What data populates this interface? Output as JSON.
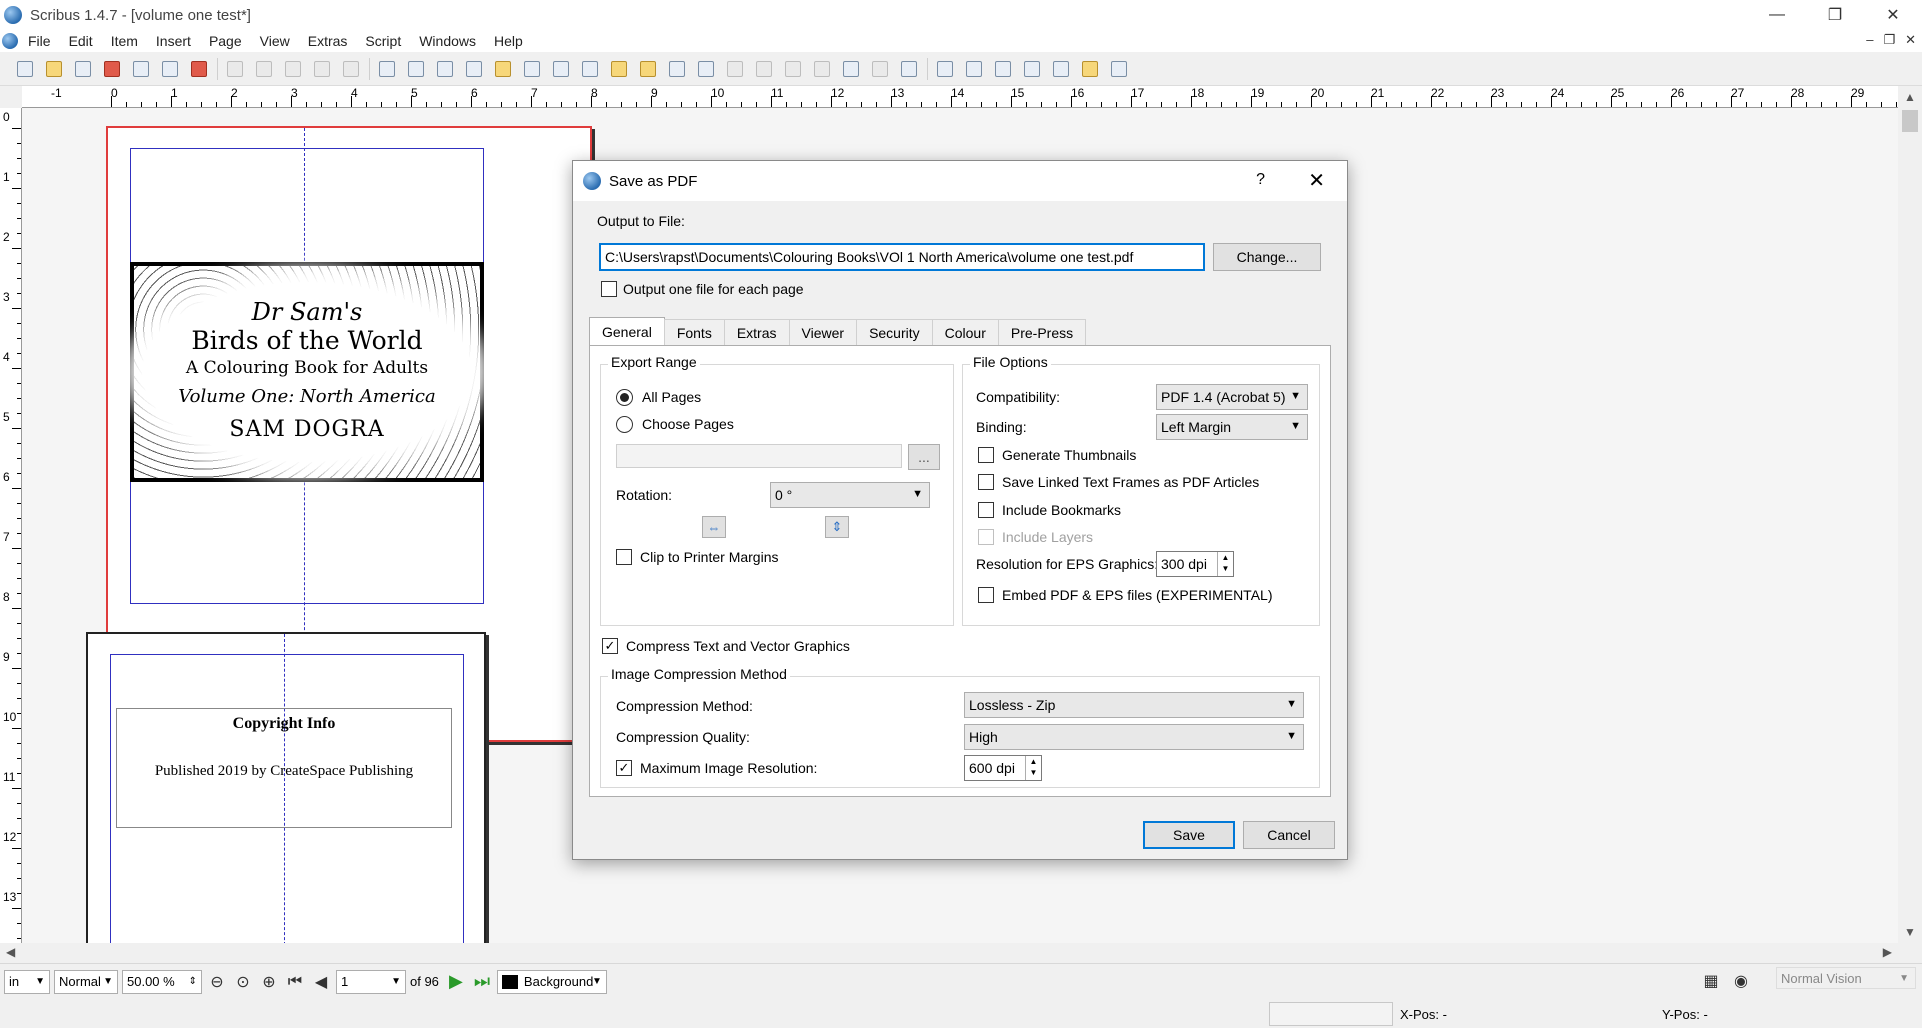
{
  "window": {
    "title": "Scribus 1.4.7 - [volume one test*]",
    "controls": [
      "—",
      "❐",
      "✕"
    ]
  },
  "menu": {
    "items": [
      "File",
      "Edit",
      "Item",
      "Insert",
      "Page",
      "View",
      "Extras",
      "Script",
      "Windows",
      "Help"
    ],
    "mdi_controls": [
      "–",
      "❐",
      "✕"
    ]
  },
  "ruler_h": [
    "-1",
    "0",
    "1",
    "2",
    "3",
    "4",
    "5",
    "6",
    "7",
    "8",
    "9",
    "10",
    "11",
    "12",
    "13",
    "14",
    "15",
    "16",
    "17",
    "18",
    "19",
    "20",
    "21",
    "22",
    "23",
    "24",
    "25",
    "26",
    "27",
    "28",
    "29"
  ],
  "ruler_v": [
    "0",
    "1",
    "2",
    "3",
    "4",
    "5",
    "6",
    "7",
    "8",
    "9",
    "10",
    "11",
    "12",
    "13"
  ],
  "page1": {
    "line1": "Dr Sam's",
    "line2": "Birds of the World",
    "line3": "A Colouring Book for Adults",
    "line4": "Volume One: North America",
    "line5": "SAM DOGRA"
  },
  "page2": {
    "heading": "Copyright Info",
    "text": "Published 2019 by CreateSpace Publishing"
  },
  "dialog": {
    "title": "Save as PDF",
    "help": "?",
    "close": "✕",
    "output_label": "Output to File:",
    "output_path": "C:\\Users\\rapst\\Documents\\Colouring Books\\VOl 1 North America\\volume one test.pdf",
    "change_button": "Change...",
    "one_file_each_page": "Output one file for each page",
    "tabs": [
      "General",
      "Fonts",
      "Extras",
      "Viewer",
      "Security",
      "Colour",
      "Pre-Press"
    ],
    "export_range": {
      "title": "Export Range",
      "all_pages": "All Pages",
      "choose_pages": "Choose Pages",
      "pages_button": "...",
      "rotation_label": "Rotation:",
      "rotation_value": "0 °",
      "clip_printer": "Clip to Printer Margins"
    },
    "file_options": {
      "title": "File Options",
      "compat_label": "Compatibility:",
      "compat_value": "PDF 1.4 (Acrobat 5)",
      "binding_label": "Binding:",
      "binding_value": "Left Margin",
      "gen_thumbs": "Generate Thumbnails",
      "save_linked": "Save Linked Text Frames as PDF Articles",
      "include_bookmarks": "Include Bookmarks",
      "include_layers": "Include Layers",
      "eps_res_label": "Resolution for EPS Graphics:",
      "eps_res_value": "300 dpi",
      "embed_pdf": "Embed PDF & EPS files (EXPERIMENTAL)"
    },
    "compress_text": "Compress Text and Vector Graphics",
    "image_compression": {
      "title": "Image Compression Method",
      "method_label": "Compression Method:",
      "method_value": "Lossless - Zip",
      "quality_label": "Compression Quality:",
      "quality_value": "High",
      "max_res_label": "Maximum Image Resolution:",
      "max_res_value": "600 dpi"
    },
    "save_button": "Save",
    "cancel_button": "Cancel"
  },
  "statusbar": {
    "unit": "in",
    "mode": "Normal",
    "zoom": "50.00 %",
    "page_current": "1",
    "page_total": "of 96",
    "layer": "Background",
    "vision": "Normal Vision",
    "xpos_label": "X-Pos:",
    "xpos_value": "-",
    "ypos_label": "Y-Pos:",
    "ypos_value": "-"
  }
}
